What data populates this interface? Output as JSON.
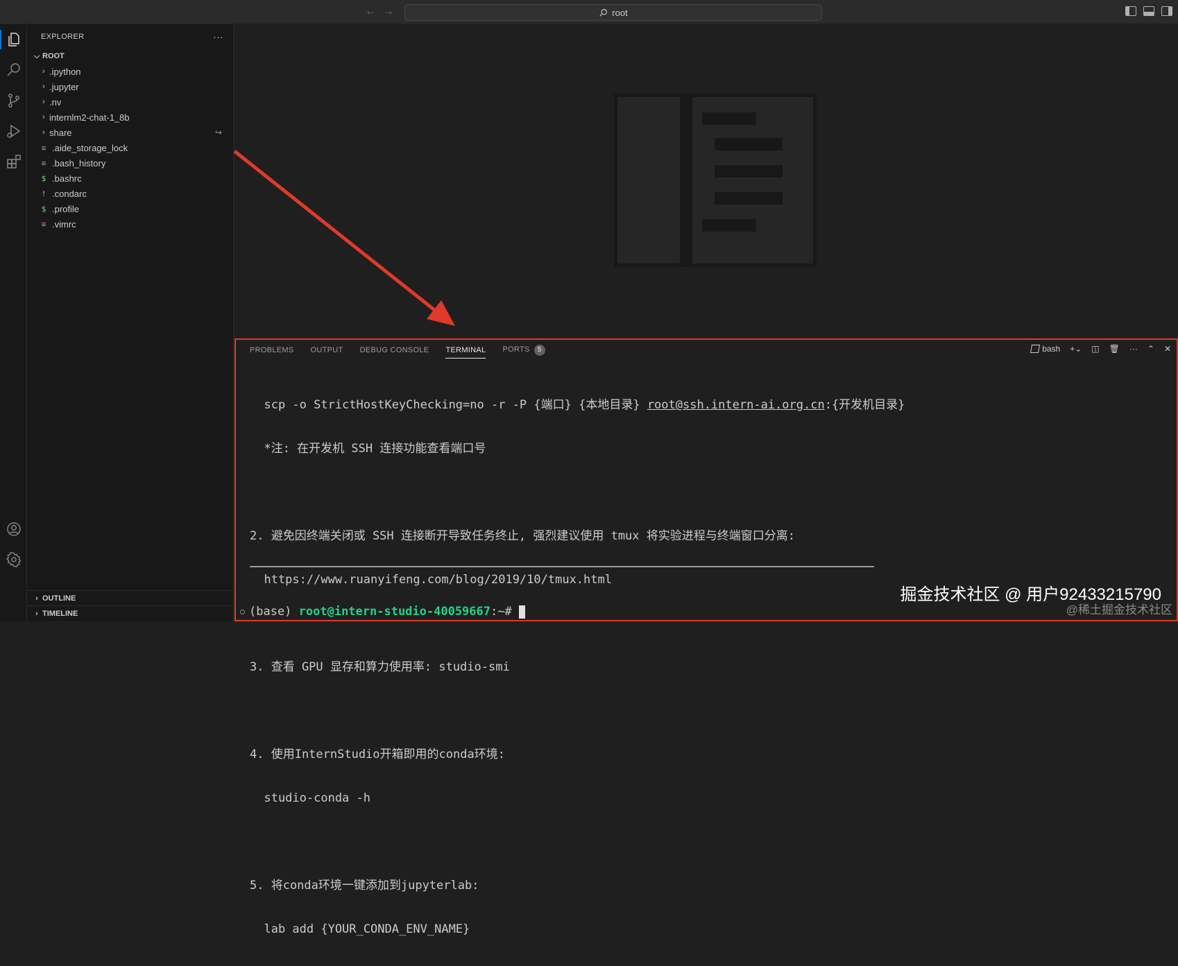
{
  "titlebar": {
    "search_text": "root",
    "back_icon": "arrow-left-icon",
    "forward_icon": "arrow-right-icon"
  },
  "activity_bar": [
    "files-icon",
    "search-icon",
    "source-control-icon",
    "run-debug-icon",
    "extensions-icon",
    "account-icon",
    "settings-gear-icon"
  ],
  "sidebar": {
    "header": "EXPLORER",
    "more": "···",
    "root_label": "ROOT",
    "folders": [
      ".ipython",
      ".jupyter",
      ".nv",
      "internlm2-chat-1_8b",
      "share"
    ],
    "files": [
      {
        "name": ".aide_storage_lock",
        "icon": "≡"
      },
      {
        "name": ".bash_history",
        "icon": "≡"
      },
      {
        "name": ".bashrc",
        "icon": "$"
      },
      {
        "name": ".condarc",
        "icon": "!"
      },
      {
        "name": ".profile",
        "icon": "$"
      },
      {
        "name": ".vimrc",
        "icon": "≡"
      }
    ],
    "outline": "OUTLINE",
    "timeline": "TIMELINE"
  },
  "panel": {
    "tabs": [
      "PROBLEMS",
      "OUTPUT",
      "DEBUG CONSOLE",
      "TERMINAL",
      "PORTS"
    ],
    "ports_badge": "5",
    "terminal_name": "bash",
    "colors": {
      "accent_border": "#e0392b",
      "prompt_user": "#23d18b"
    }
  },
  "terminal": {
    "line1_pre": "  scp -o StrictHostKeyChecking=no -r -P {端口} {本地目录} ",
    "line1_link": "root@ssh.intern-ai.org.cn",
    "line1_post": ":{开发机目录}",
    "line2": "  *注: 在开发机 SSH 连接功能查看端口号",
    "line3": "2. 避免因终端关闭或 SSH 连接断开导致任务终止, 强烈建议使用 tmux 将实验进程与终端窗口分离:",
    "line4": "  https://www.ruanyifeng.com/blog/2019/10/tmux.html",
    "line5": "3. 查看 GPU 显存和算力使用率: studio-smi",
    "line6": "4. 使用InternStudio开箱即用的conda环境:",
    "line7": "  studio-conda -h",
    "line8": "5. 将conda环境一键添加到jupyterlab:",
    "line9": "  lab add {YOUR_CONDA_ENV_NAME}",
    "separator": "──────────────────────────────────────────────────────────────────────────────────────────────────────────────────",
    "prompt_env": "(base) ",
    "prompt_user": "root@intern-studio-40059667",
    "prompt_suffix": ":~# "
  },
  "watermark": {
    "main": "掘金技术社区 @ 用户92433215790",
    "sub": "@稀土掘金技术社区"
  }
}
